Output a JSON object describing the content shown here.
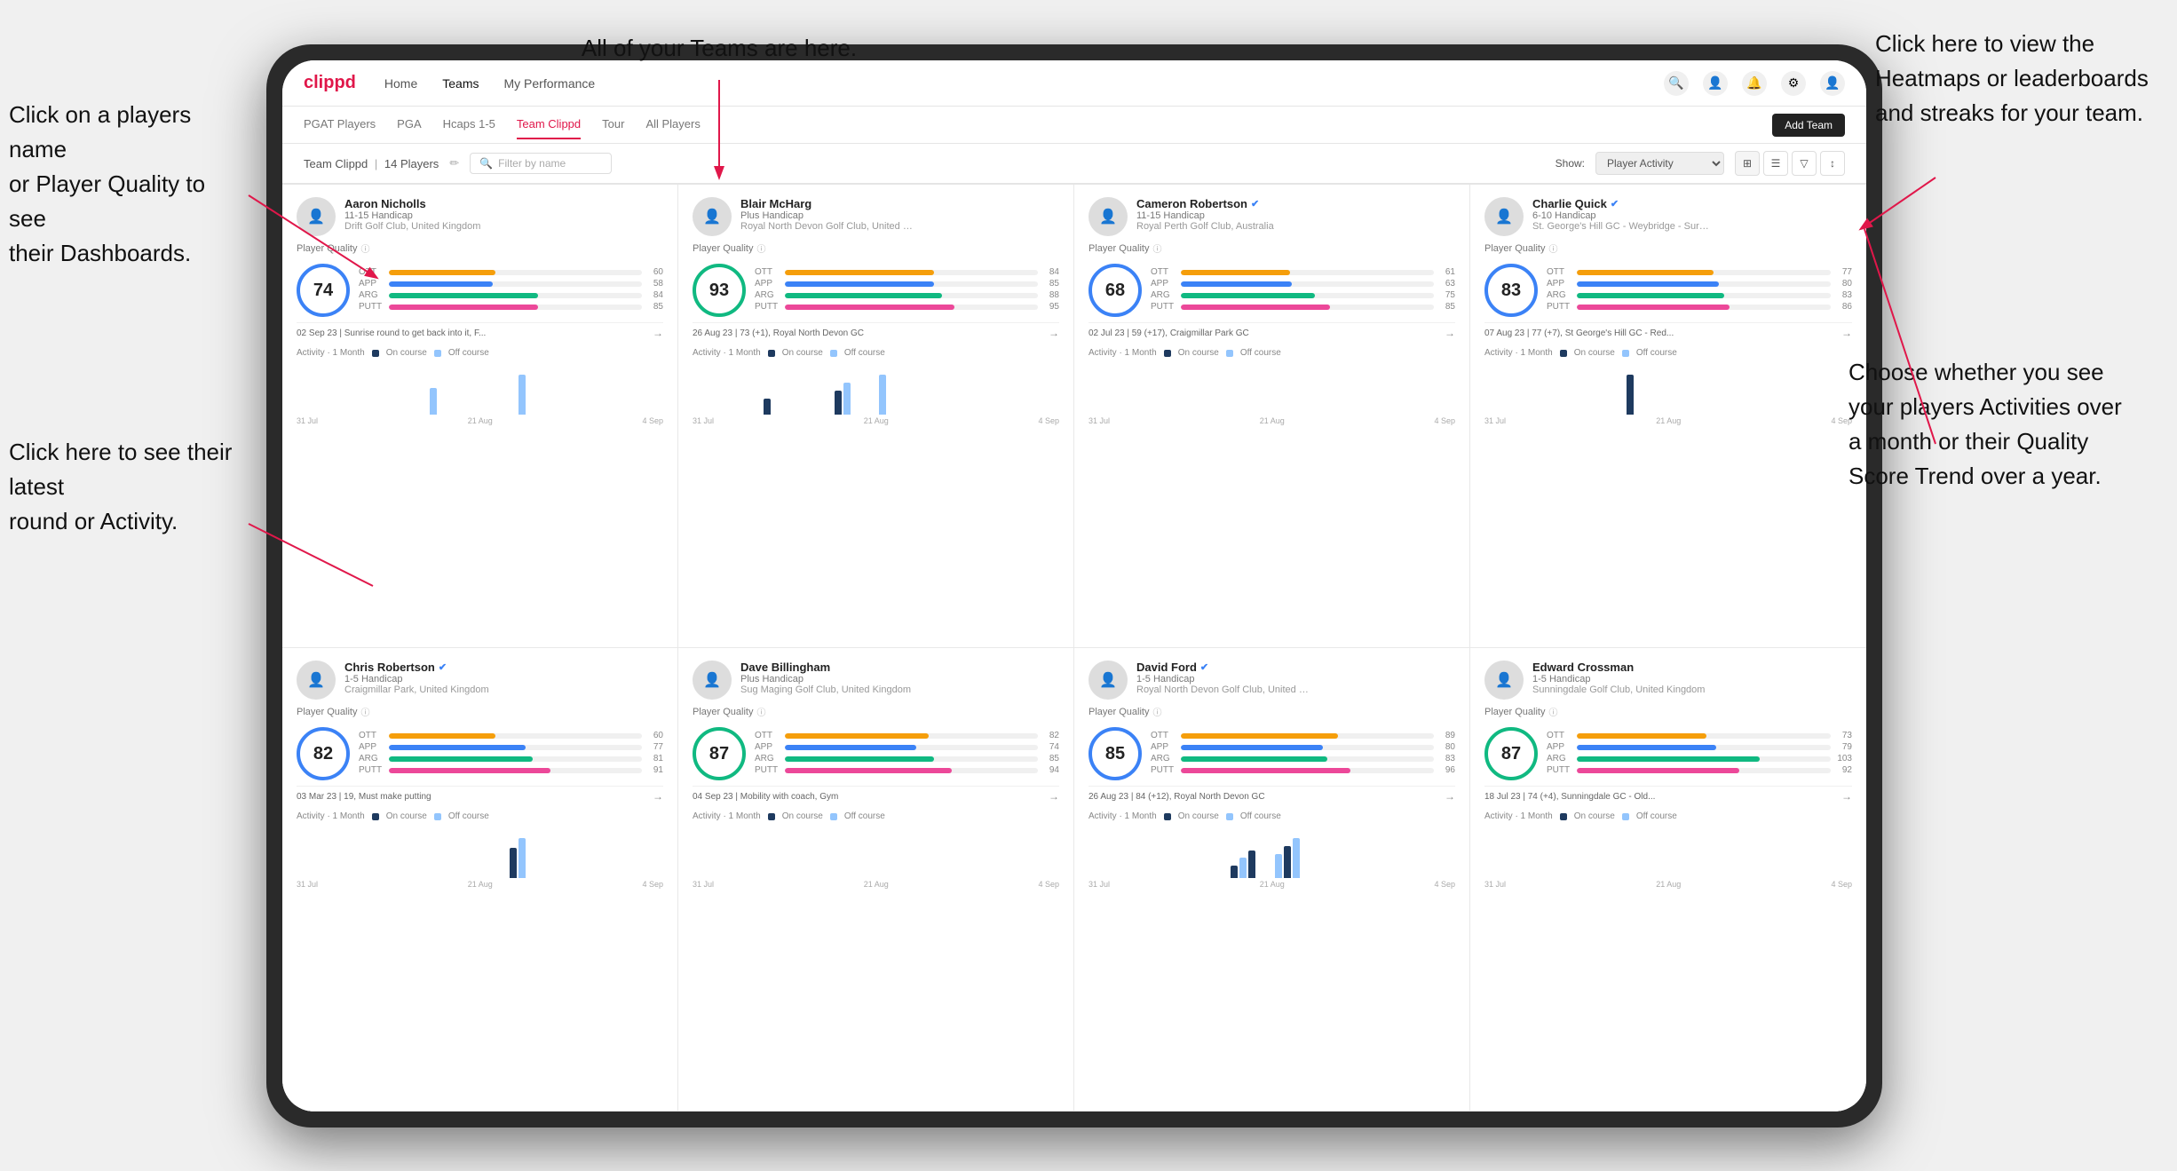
{
  "annotations": {
    "left1": "Click on a players name\nor Player Quality to see\ntheir Dashboards.",
    "left2": "Click here to see their latest\nround or Activity.",
    "top": "All of your Teams are here.",
    "right1": "Click here to view the\nHeatmaps or leaderboards\nand streaks for your team.",
    "right2": "Choose whether you see\nyour players Activities over\na month or their Quality\nScore Trend over a year."
  },
  "nav": {
    "logo": "clippd",
    "links": [
      "Home",
      "Teams",
      "My Performance"
    ],
    "active": "Teams"
  },
  "subnav": {
    "links": [
      "PGAT Players",
      "PGA",
      "Hcaps 1-5",
      "Team Clippd",
      "Tour",
      "All Players"
    ],
    "active": "Team Clippd",
    "addTeam": "Add Team"
  },
  "teamHeader": {
    "title": "Team Clippd",
    "count": "14 Players",
    "searchPlaceholder": "Filter by name",
    "showLabel": "Show:",
    "showValue": "Player Activity",
    "views": [
      "grid-2",
      "grid-3",
      "filter",
      "sort"
    ]
  },
  "players": [
    {
      "name": "Aaron Nicholls",
      "handicap": "11-15 Handicap",
      "club": "Drift Golf Club, United Kingdom",
      "quality": 74,
      "qualityColor": "blue",
      "stats": {
        "ott": 60,
        "app": 58,
        "arg": 84,
        "putt": 85
      },
      "latestRound": "02 Sep 23 | Sunrise round to get back into it, F...",
      "avatar": "👤",
      "verified": false,
      "chartBars": [
        0,
        0,
        0,
        0,
        0,
        0,
        0,
        0,
        0,
        0,
        0,
        0,
        0,
        0,
        0,
        2,
        0,
        0,
        0,
        0,
        0,
        0,
        0,
        0,
        0,
        3,
        0,
        0
      ]
    },
    {
      "name": "Blair McHarg",
      "handicap": "Plus Handicap",
      "club": "Royal North Devon Golf Club, United Kin...",
      "quality": 93,
      "qualityColor": "green",
      "stats": {
        "ott": 84,
        "app": 85,
        "arg": 88,
        "putt": 95
      },
      "latestRound": "26 Aug 23 | 73 (+1), Royal North Devon GC",
      "avatar": "👤",
      "verified": false,
      "chartBars": [
        0,
        0,
        0,
        0,
        0,
        0,
        0,
        0,
        2,
        0,
        0,
        0,
        0,
        0,
        0,
        0,
        3,
        4,
        0,
        0,
        0,
        5,
        0,
        0,
        0,
        0,
        0,
        0
      ]
    },
    {
      "name": "Cameron Robertson",
      "handicap": "11-15 Handicap",
      "club": "Royal Perth Golf Club, Australia",
      "quality": 68,
      "qualityColor": "blue",
      "stats": {
        "ott": 61,
        "app": 63,
        "arg": 75,
        "putt": 85
      },
      "latestRound": "02 Jul 23 | 59 (+17), Craigmillar Park GC",
      "avatar": "👤",
      "verified": true,
      "chartBars": [
        0,
        0,
        0,
        0,
        0,
        0,
        0,
        0,
        0,
        0,
        0,
        0,
        0,
        0,
        0,
        0,
        0,
        0,
        0,
        0,
        0,
        0,
        0,
        0,
        0,
        0,
        0,
        0
      ]
    },
    {
      "name": "Charlie Quick",
      "handicap": "6-10 Handicap",
      "club": "St. George's Hill GC - Weybridge - Surrey...",
      "quality": 83,
      "qualityColor": "blue",
      "stats": {
        "ott": 77,
        "app": 80,
        "arg": 83,
        "putt": 86
      },
      "latestRound": "07 Aug 23 | 77 (+7), St George's Hill GC - Red...",
      "avatar": "👤",
      "verified": true,
      "chartBars": [
        0,
        0,
        0,
        0,
        0,
        0,
        0,
        0,
        0,
        0,
        0,
        0,
        0,
        0,
        0,
        0,
        2,
        0,
        0,
        0,
        0,
        0,
        0,
        0,
        0,
        0,
        0,
        0
      ]
    },
    {
      "name": "Chris Robertson",
      "handicap": "1-5 Handicap",
      "club": "Craigmillar Park, United Kingdom",
      "quality": 82,
      "qualityColor": "blue",
      "stats": {
        "ott": 60,
        "app": 77,
        "arg": 81,
        "putt": 91
      },
      "latestRound": "03 Mar 23 | 19, Must make putting",
      "avatar": "👤",
      "verified": true,
      "chartBars": [
        0,
        0,
        0,
        0,
        0,
        0,
        0,
        0,
        0,
        0,
        0,
        0,
        0,
        0,
        0,
        0,
        0,
        0,
        0,
        0,
        0,
        0,
        0,
        0,
        3,
        4,
        0,
        0
      ]
    },
    {
      "name": "Dave Billingham",
      "handicap": "Plus Handicap",
      "club": "Sug Maging Golf Club, United Kingdom",
      "quality": 87,
      "qualityColor": "green",
      "stats": {
        "ott": 82,
        "app": 74,
        "arg": 85,
        "putt": 94
      },
      "latestRound": "04 Sep 23 | Mobility with coach, Gym",
      "avatar": "👤",
      "verified": false,
      "chartBars": [
        0,
        0,
        0,
        0,
        0,
        0,
        0,
        0,
        0,
        0,
        0,
        0,
        0,
        0,
        0,
        0,
        0,
        0,
        0,
        0,
        0,
        0,
        0,
        0,
        0,
        0,
        0,
        0
      ]
    },
    {
      "name": "David Ford",
      "handicap": "1-5 Handicap",
      "club": "Royal North Devon Golf Club, United Kni...",
      "quality": 85,
      "qualityColor": "blue",
      "stats": {
        "ott": 89,
        "app": 80,
        "arg": 83,
        "putt": 96
      },
      "latestRound": "26 Aug 23 | 84 (+12), Royal North Devon GC",
      "avatar": "👤",
      "verified": true,
      "chartBars": [
        0,
        0,
        0,
        0,
        0,
        0,
        0,
        0,
        0,
        0,
        0,
        0,
        0,
        0,
        0,
        0,
        3,
        5,
        7,
        0,
        0,
        6,
        8,
        10,
        0,
        0,
        0,
        0
      ]
    },
    {
      "name": "Edward Crossman",
      "handicap": "1-5 Handicap",
      "club": "Sunningdale Golf Club, United Kingdom",
      "quality": 87,
      "qualityColor": "green",
      "stats": {
        "ott": 73,
        "app": 79,
        "arg": 103,
        "putt": 92
      },
      "latestRound": "18 Jul 23 | 74 (+4), Sunningdale GC - Old...",
      "avatar": "👤",
      "verified": false,
      "chartBars": [
        0,
        0,
        0,
        0,
        0,
        0,
        0,
        0,
        0,
        0,
        0,
        0,
        0,
        0,
        0,
        0,
        0,
        0,
        0,
        0,
        0,
        0,
        0,
        0,
        0,
        0,
        0,
        0
      ]
    }
  ]
}
